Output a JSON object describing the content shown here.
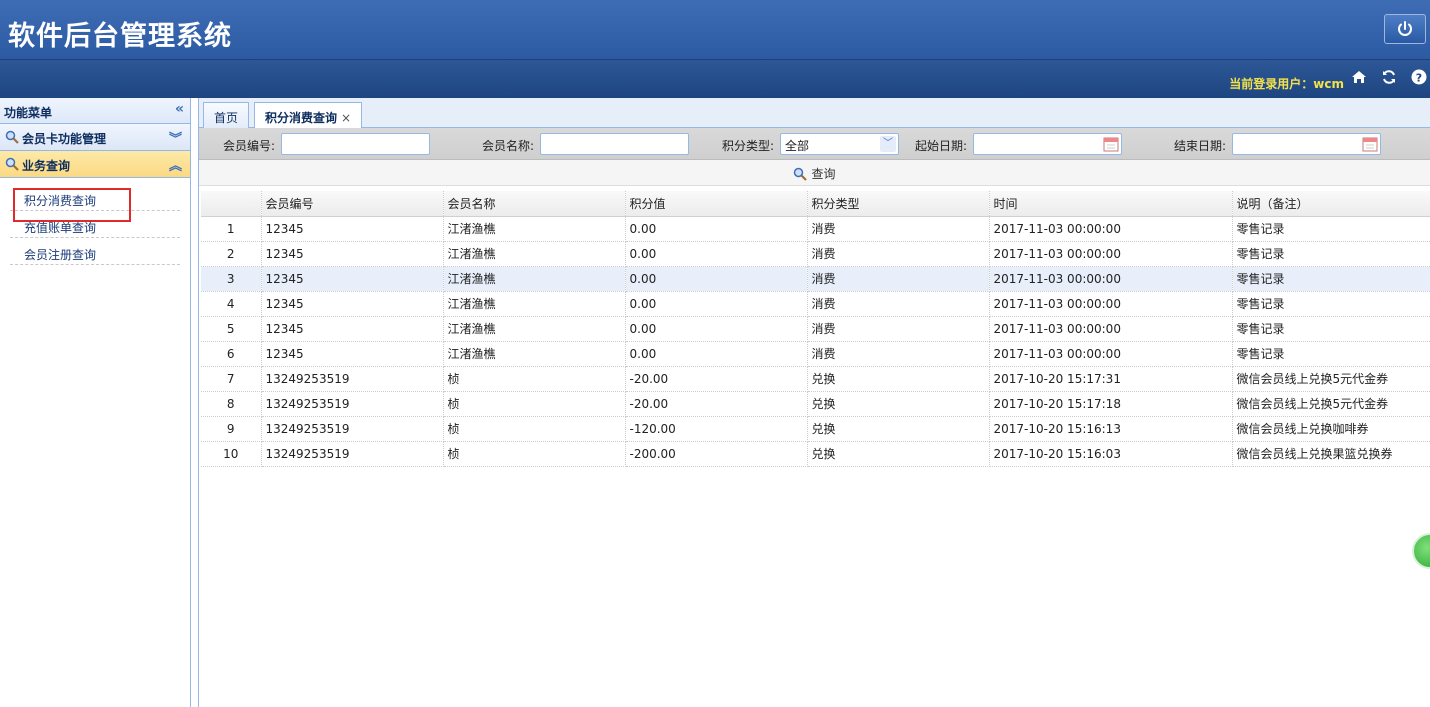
{
  "header": {
    "title": "软件后台管理系统",
    "login_user": "当前登录用户：wcm"
  },
  "sidebar": {
    "title": "功能菜单",
    "groups": [
      {
        "label": "会员卡功能管理",
        "expanded": false
      },
      {
        "label": "业务查询",
        "expanded": true
      }
    ],
    "items": [
      {
        "label": "积分消费查询"
      },
      {
        "label": "充值账单查询"
      },
      {
        "label": "会员注册查询"
      }
    ]
  },
  "tabs": [
    {
      "label": "首页"
    },
    {
      "label": "积分消费查询",
      "close": "×"
    }
  ],
  "search": {
    "member_id_label": "会员编号:",
    "member_name_label": "会员名称:",
    "points_type_label": "积分类型:",
    "points_type_value": "全部",
    "start_date_label": "起始日期:",
    "end_date_label": "结束日期:",
    "query_label": "查询"
  },
  "table": {
    "columns": [
      "",
      "会员编号",
      "会员名称",
      "积分值",
      "积分类型",
      "时间",
      "说明（备注）"
    ],
    "rows": [
      [
        "1",
        "12345",
        "江渚渔樵",
        "0.00",
        "消费",
        "2017-11-03 00:00:00",
        "零售记录"
      ],
      [
        "2",
        "12345",
        "江渚渔樵",
        "0.00",
        "消费",
        "2017-11-03 00:00:00",
        "零售记录"
      ],
      [
        "3",
        "12345",
        "江渚渔樵",
        "0.00",
        "消费",
        "2017-11-03 00:00:00",
        "零售记录"
      ],
      [
        "4",
        "12345",
        "江渚渔樵",
        "0.00",
        "消费",
        "2017-11-03 00:00:00",
        "零售记录"
      ],
      [
        "5",
        "12345",
        "江渚渔樵",
        "0.00",
        "消费",
        "2017-11-03 00:00:00",
        "零售记录"
      ],
      [
        "6",
        "12345",
        "江渚渔樵",
        "0.00",
        "消费",
        "2017-11-03 00:00:00",
        "零售记录"
      ],
      [
        "7",
        "13249253519",
        "桢",
        "-20.00",
        "兑换",
        "2017-10-20 15:17:31",
        "微信会员线上兑换5元代金券"
      ],
      [
        "8",
        "13249253519",
        "桢",
        "-20.00",
        "兑换",
        "2017-10-20 15:17:18",
        "微信会员线上兑换5元代金券"
      ],
      [
        "9",
        "13249253519",
        "桢",
        "-120.00",
        "兑换",
        "2017-10-20 15:16:13",
        "微信会员线上兑换咖啡券"
      ],
      [
        "10",
        "13249253519",
        "桢",
        "-200.00",
        "兑换",
        "2017-10-20 15:16:03",
        "微信会员线上兑换果篮兑换券"
      ]
    ],
    "highlighted_row": 3
  }
}
